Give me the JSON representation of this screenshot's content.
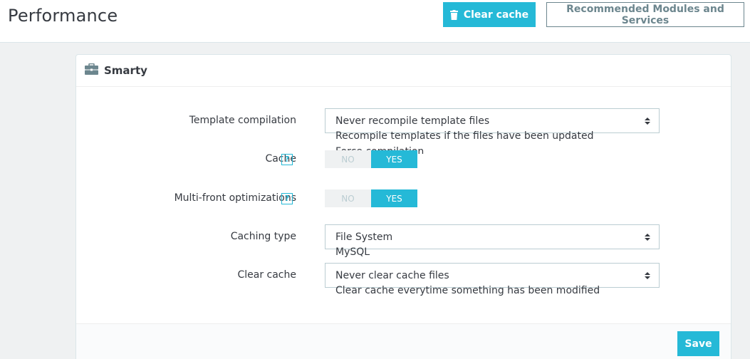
{
  "header": {
    "title": "Performance",
    "clear_cache_label": "Clear cache",
    "recommended_label": "Recommended Modules and Services"
  },
  "panel": {
    "title": "Smarty",
    "fields": {
      "template_compilation": {
        "label": "Template compilation",
        "selected": "Never recompile template files",
        "options_below": [
          "Recompile templates if the files have been updated",
          "Force compilation"
        ]
      },
      "cache": {
        "label": "Cache",
        "help": "?",
        "no": "NO",
        "yes": "YES"
      },
      "multi_front": {
        "label": "Multi-front optimizations",
        "help": "?",
        "no": "NO",
        "yes": "YES"
      },
      "caching_type": {
        "label": "Caching type",
        "selected": "File System",
        "options_below": [
          "MySQL"
        ]
      },
      "clear_cache": {
        "label": "Clear cache",
        "selected": "Never clear cache files",
        "options_below": [
          "Clear cache everytime something has been modified"
        ]
      }
    },
    "save_label": "Save"
  },
  "colors": {
    "accent": "#25b9d7",
    "text": "#363a41",
    "background": "#eff1f2"
  },
  "icons": [
    "trash-icon",
    "briefcase-icon",
    "select-arrows-icon"
  ]
}
